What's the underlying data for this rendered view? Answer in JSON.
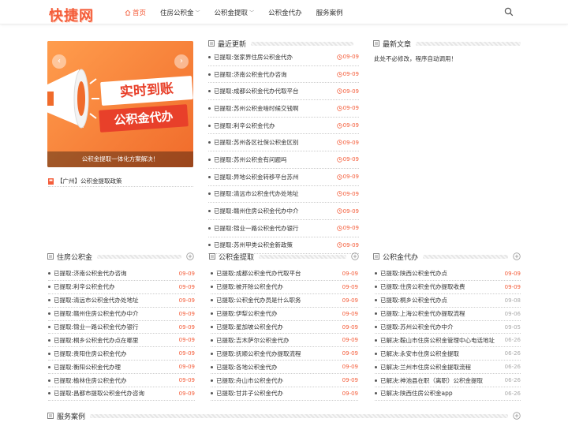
{
  "header": {
    "logo": "快捷网",
    "nav": [
      {
        "label": "首页",
        "active": true,
        "dropdown": false
      },
      {
        "label": "住房公积金",
        "active": false,
        "dropdown": true
      },
      {
        "label": "公积金提取",
        "active": false,
        "dropdown": true
      },
      {
        "label": "公积金代办",
        "active": false,
        "dropdown": false
      },
      {
        "label": "服务案例",
        "active": false,
        "dropdown": false
      }
    ],
    "search_icon": "search-icon"
  },
  "slider": {
    "banner_line1": "实时到账",
    "banner_line2": "公积金代办",
    "caption": "公积金提取一体化方案解决！",
    "prev": "‹",
    "next": "›"
  },
  "slider_news": "【广州】公积金提取政策",
  "recent": {
    "title": "最近更新",
    "items": [
      {
        "text": "已提取:张家界住房公积金代办",
        "date": "09-09"
      },
      {
        "text": "已提取:济南公积金代办咨询",
        "date": "09-09"
      },
      {
        "text": "已提取:成都公积金代办代取平台",
        "date": "09-09"
      },
      {
        "text": "已提取:苏州公积金啥时候交钱啊",
        "date": "09-09"
      },
      {
        "text": "已提取:利辛公积金代办",
        "date": "09-09"
      },
      {
        "text": "已提取:苏州各区社保公积金区别",
        "date": "09-09"
      },
      {
        "text": "已提取:苏州公积金有问题吗",
        "date": "09-09"
      },
      {
        "text": "已提取:异地公积金转移平台苏州",
        "date": "09-09"
      },
      {
        "text": "已提取:清远市公积金代办处地址",
        "date": "09-09"
      },
      {
        "text": "已提取:赣州住房公积金代办中介",
        "date": "09-09"
      },
      {
        "text": "已提取:锦业一路公积金代办银行",
        "date": "09-09"
      },
      {
        "text": "已提取:苏州甲类公积金新政策",
        "date": "09-09"
      }
    ]
  },
  "latest": {
    "title": "最新文章",
    "text": "此处不必修改，程序自动调用！"
  },
  "housing": {
    "title": "住房公积金",
    "items": [
      {
        "text": "已提取:济南公积金代办咨询",
        "date": "09-09"
      },
      {
        "text": "已提取:利辛公积金代办",
        "date": "09-09"
      },
      {
        "text": "已提取:清远市公积金代办处地址",
        "date": "09-09"
      },
      {
        "text": "已提取:赣州住房公积金代办中介",
        "date": "09-09"
      },
      {
        "text": "已提取:锦业一路公积金代办银行",
        "date": "09-09"
      },
      {
        "text": "已提取:桐乡公积金代办点在哪里",
        "date": "09-09"
      },
      {
        "text": "已提取:贵阳住房公积金代办",
        "date": "09-09"
      },
      {
        "text": "已提取:衡阳公积金代办理",
        "date": "09-09"
      },
      {
        "text": "已提取:榆林住房公积金代办",
        "date": "09-09"
      },
      {
        "text": "已提取:昌都市提取公积金代办咨询",
        "date": "09-09"
      }
    ]
  },
  "withdraw": {
    "title": "公积金提取",
    "items": [
      {
        "text": "已提取:成都公积金代办代取平台",
        "date": "09-09"
      },
      {
        "text": "已提取:被开除公积金代办",
        "date": "09-09"
      },
      {
        "text": "已提取:公积金代办员是什么职务",
        "date": "09-09"
      },
      {
        "text": "已提取:伊犁公积金代办",
        "date": "09-09"
      },
      {
        "text": "已提取:星加坡公积金代办",
        "date": "09-09"
      },
      {
        "text": "已提取:吉木萨尔公积金代办",
        "date": "09-09"
      },
      {
        "text": "已提取:抚顺公积金代办提取流程",
        "date": "09-09"
      },
      {
        "text": "已提取:各地公积金代办",
        "date": "09-09"
      },
      {
        "text": "已提取:舟山市公积金代办",
        "date": "09-09"
      },
      {
        "text": "已提取:甘井子公积金代办",
        "date": "09-09"
      }
    ]
  },
  "agency": {
    "title": "公积金代办",
    "items": [
      {
        "text": "已提取:陕西公积金代办点",
        "date": "09-09",
        "hot": true
      },
      {
        "text": "已提取:住房公积金代办提取收费",
        "date": "09-09",
        "hot": false
      },
      {
        "text": "已提取:桐乡公积金代办点",
        "date": "09-08",
        "hot": false
      },
      {
        "text": "已提取:上海公积金代办提取流程",
        "date": "09-06",
        "hot": false
      },
      {
        "text": "已提取:苏州公积金代办中介",
        "date": "09-05",
        "hot": false
      },
      {
        "text": "已解决:鞍山市住房公积金管理中心电话地址",
        "date": "06-26",
        "hot": false
      },
      {
        "text": "已解决:永安市住房公积金提取",
        "date": "06-26",
        "hot": false
      },
      {
        "text": "已解决:兰州市住房公积金提取流程",
        "date": "06-26",
        "hot": false
      },
      {
        "text": "已解决:神池县在职（离职）公积金提取",
        "date": "06-26",
        "hot": false
      },
      {
        "text": "已解决:陕西住房公积金app",
        "date": "06-26",
        "hot": false
      }
    ]
  },
  "cases": {
    "title": "服务案例"
  }
}
